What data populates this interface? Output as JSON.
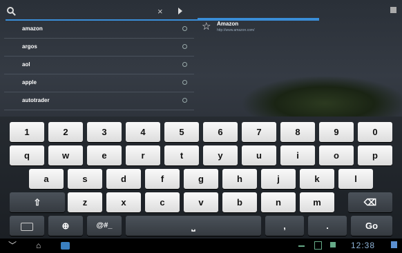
{
  "search": {
    "value": "",
    "placeholder": "",
    "clear_glyph": "×"
  },
  "suggestions": [
    {
      "text": "amazon"
    },
    {
      "text": "argos"
    },
    {
      "text": "aol"
    },
    {
      "text": "apple"
    },
    {
      "text": "autotrader"
    }
  ],
  "bookmark": {
    "title": "Amazon",
    "url": "http://www.amazon.com/",
    "icon": "star-icon"
  },
  "keyboard": {
    "row1": [
      "1",
      "2",
      "3",
      "4",
      "5",
      "6",
      "7",
      "8",
      "9",
      "0"
    ],
    "row2": [
      "q",
      "w",
      "e",
      "r",
      "t",
      "y",
      "u",
      "i",
      "o",
      "p"
    ],
    "row3": [
      "a",
      "s",
      "d",
      "f",
      "g",
      "h",
      "j",
      "k",
      "l"
    ],
    "row4": [
      "z",
      "x",
      "c",
      "v",
      "b",
      "n",
      "m"
    ],
    "symbols_label": "@#_",
    "comma": ",",
    "period": ".",
    "go_label": "Go",
    "shift_glyph": "⇧",
    "backspace_glyph": "⌫",
    "space_glyph": "⎵"
  },
  "navbar": {
    "time": "12:38",
    "back_glyph": "﹀",
    "home_glyph": "⌂"
  }
}
